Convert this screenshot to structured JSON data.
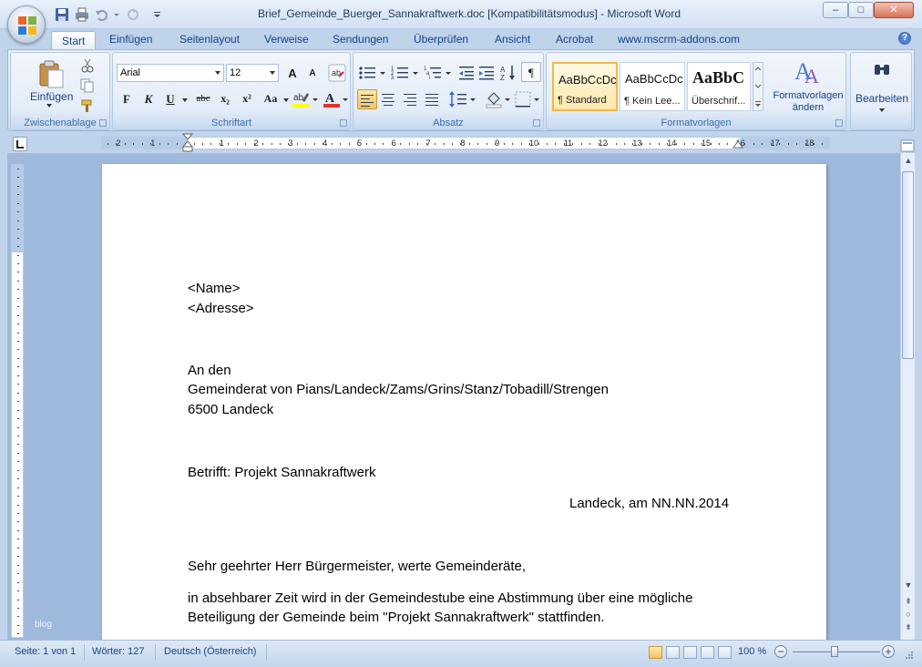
{
  "window": {
    "title": "Brief_Gemeinde_Buerger_Sannakraftwerk.doc [Kompatibilitätsmodus] - Microsoft Word",
    "controls": {
      "minimize": "–",
      "maximize": "□",
      "close": "✕"
    }
  },
  "tabs": [
    "Start",
    "Einfügen",
    "Seitenlayout",
    "Verweise",
    "Sendungen",
    "Überprüfen",
    "Ansicht",
    "Acrobat",
    "www.mscrm-addons.com"
  ],
  "ribbon": {
    "clipboard": {
      "paste_label": "Einfügen",
      "group_label": "Zwischenablage"
    },
    "font": {
      "group_label": "Schriftart",
      "font_name": "Arial",
      "font_size": "12",
      "bold": "F",
      "italic": "K",
      "underline": "U",
      "strike": "abc",
      "subscript": "x₂",
      "superscript": "x²",
      "case": "Aa",
      "grow": "A",
      "shrink": "A"
    },
    "paragraph": {
      "group_label": "Absatz",
      "pilcrow": "¶"
    },
    "styles": {
      "group_label": "Formatvorlagen",
      "items": [
        {
          "sample": "AaBbCcDc",
          "name": "¶ Standard"
        },
        {
          "sample": "AaBbCcDc",
          "name": "¶ Kein Lee..."
        },
        {
          "sample": "AaBbC",
          "name": "Überschrif..."
        }
      ],
      "change_label_1": "Formatvorlagen",
      "change_label_2": "ändern"
    },
    "editing": {
      "label": "Bearbeiten"
    }
  },
  "ruler": {
    "numbers": [
      "2",
      "1",
      "1",
      "2",
      "3",
      "4",
      "5",
      "6",
      "7",
      "8",
      "9",
      "10",
      "11",
      "12",
      "13",
      "14",
      "15",
      "16",
      "17",
      "18"
    ]
  },
  "document": {
    "lines": [
      "<Name>",
      "<Adresse>",
      "An den",
      "Gemeinderat von Pians/Landeck/Zams/Grins/Stanz/Tobadill/Strengen",
      "6500 Landeck",
      "Betrifft: Projekt Sannakraftwerk",
      "Landeck, am NN.NN.2014",
      "Sehr geehrter Herr Bürgermeister, werte Gemeinderäte,",
      "in absehbarer Zeit wird in der Gemeindestube eine Abstimmung über eine mögliche",
      "Beteiligung der Gemeinde beim \"Projekt Sannakraftwerk\" stattfinden."
    ],
    "watermark": "blog"
  },
  "statusbar": {
    "page": "Seite: 1 von 1",
    "words": "Wörter: 127",
    "language": "Deutsch (Österreich)",
    "zoom": "100 %",
    "zoom_minus": "−",
    "zoom_plus": "+"
  }
}
